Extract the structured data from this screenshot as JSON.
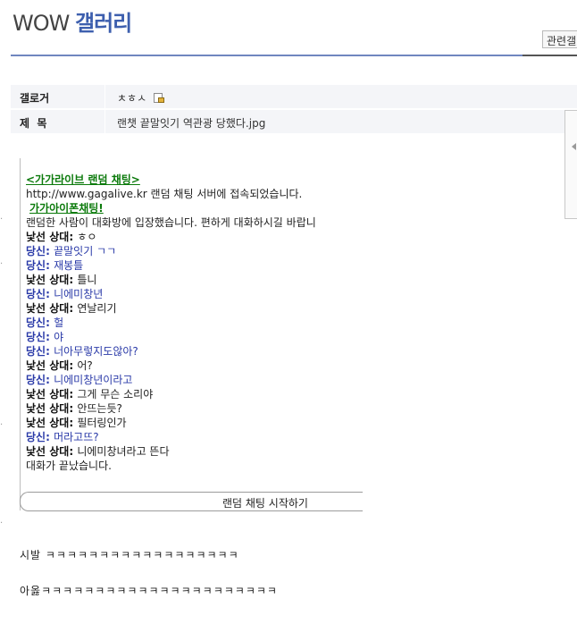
{
  "header": {
    "title_prefix": "WOW",
    "title_main": "갤러리",
    "related_button": "관련갤"
  },
  "info": {
    "author_label": "갤로거",
    "author_value": "ㅊㅎㅅ",
    "subject_label": "제  목",
    "subject_value": "랜챗 끝말잇기 역관광 당했다.jpg"
  },
  "chat": {
    "header1": "<가가라이브 랜덤 채팅>",
    "url": "http://www.gagalive.kr",
    "url_suffix": " 랜덤 채팅 서버에 접속되었습니다.",
    "header2": "가가아이폰채팅!",
    "system_enter": "랜덤한 사람이 대화방에 입장했습니다. 편하게 대화하시길 바랍니",
    "messages": [
      {
        "who": "낯선 상대",
        "text": "ㅎㅇ",
        "side": "stranger"
      },
      {
        "who": "당신",
        "text": "끝말잇기 ㄱㄱ",
        "side": "you"
      },
      {
        "who": "당신",
        "text": "재봉틀",
        "side": "you"
      },
      {
        "who": "낯선 상대",
        "text": "틀니",
        "side": "stranger"
      },
      {
        "who": "당신",
        "text": "니에미창년",
        "side": "you"
      },
      {
        "who": "낯선 상대",
        "text": "연날리기",
        "side": "stranger"
      },
      {
        "who": "당신",
        "text": "헐",
        "side": "you"
      },
      {
        "who": "당신",
        "text": "야",
        "side": "you"
      },
      {
        "who": "당신",
        "text": "너아무렇지도않아?",
        "side": "you"
      },
      {
        "who": "낯선 상대",
        "text": "어?",
        "side": "stranger"
      },
      {
        "who": "당신",
        "text": "니에미창년이라고",
        "side": "you"
      },
      {
        "who": "낯선 상대",
        "text": "그게 무슨 소리야",
        "side": "stranger"
      },
      {
        "who": "낯선 상대",
        "text": "안뜨는듯?",
        "side": "stranger"
      },
      {
        "who": "낯선 상대",
        "text": "필터링인가",
        "side": "stranger"
      },
      {
        "who": "당신",
        "text": "머라고뜨?",
        "side": "you"
      },
      {
        "who": "낯선 상대",
        "text": "니에미창녀라고 뜬다",
        "side": "stranger"
      }
    ],
    "system_end": "대화가 끝났습니다.",
    "start_button": "랜덤 채팅 시작하기"
  },
  "body_text": {
    "line1": "시발 ㅋㅋㅋㅋㅋㅋㅋㅋㅋㅋㅋㅋㅋㅋㅋㅋㅋㅋ",
    "line2": "아옳ㅋㅋㅋㅋㅋㅋㅋㅋㅋㅋㅋㅋㅋㅋㅋㅋㅋㅋㅋㅋㅋㅋ"
  },
  "colors": {
    "accent": "#3d5fae",
    "you": "#2a3aa8",
    "link_green": "#0b7a0b"
  }
}
